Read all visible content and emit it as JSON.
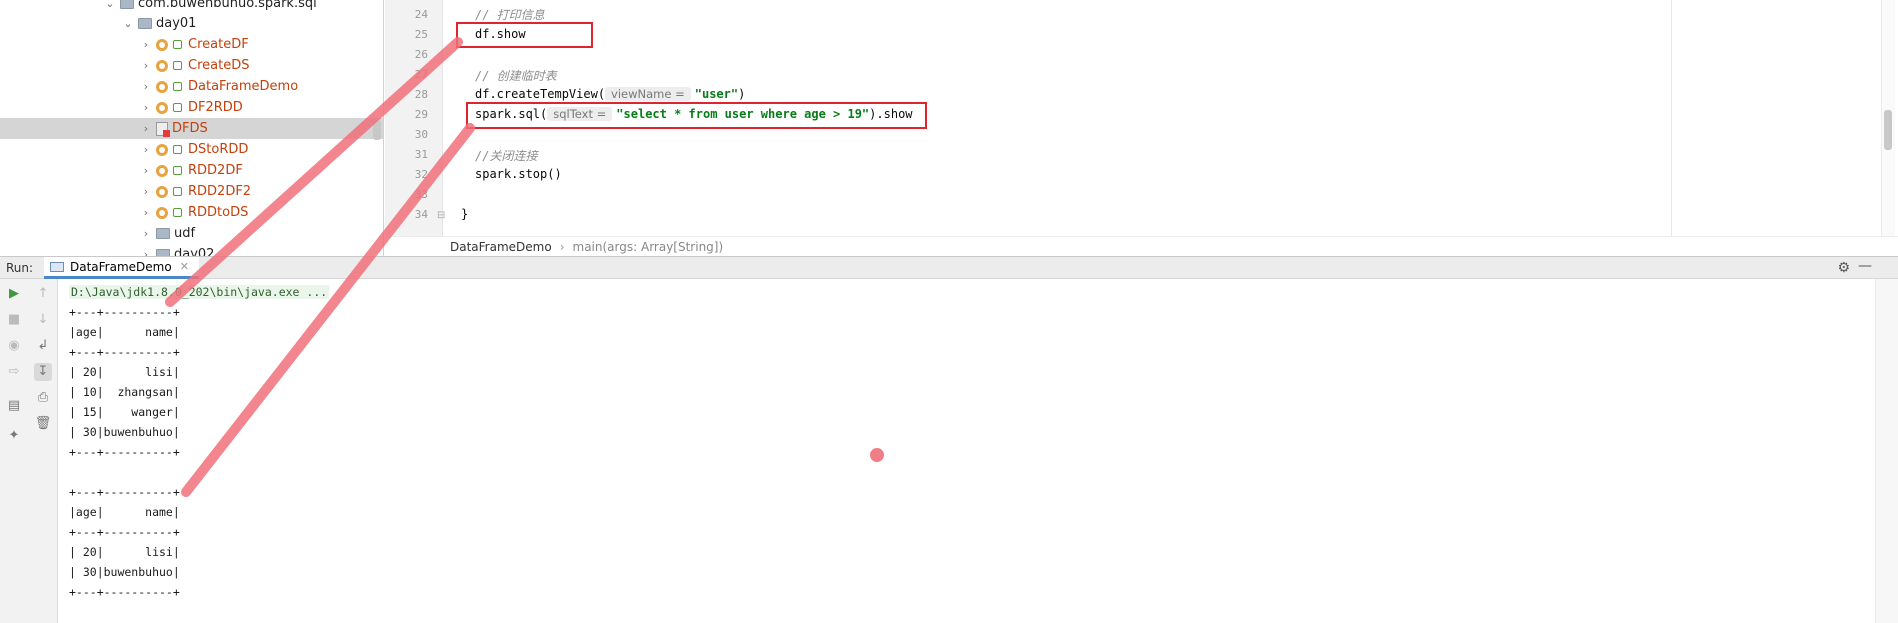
{
  "project_tree": {
    "package_root": "com.buwenbuhuo.spark.sql",
    "day01_label": "day01",
    "classes": [
      "CreateDF",
      "CreateDS",
      "DataFrameDemo",
      "DF2RDD"
    ],
    "selected_item": "DFDS",
    "classes_after": [
      "DStoRDD",
      "RDD2DF",
      "RDD2DF2",
      "RDDtoDS"
    ],
    "udf_label": "udf",
    "day02_label": "day02"
  },
  "editor": {
    "line_numbers": [
      "24",
      "25",
      "26",
      "27",
      "28",
      "29",
      "30",
      "31",
      "32",
      "33",
      "34"
    ],
    "lines": {
      "l24_comment": "// 打印信息",
      "l25_code": "df.show",
      "l27_comment": "// 创建临时表",
      "l28_prefix": "df.createTempView(",
      "l28_hint": "viewName =",
      "l28_string": "\"user\"",
      "l28_suffix": ")",
      "l29_prefix": "spark.sql(",
      "l29_hint": "sqlText =",
      "l29_string": "\"select * from user where age > 19\"",
      "l29_suffix": ").show",
      "l31_comment": "//关闭连接",
      "l32_code": "spark.stop()",
      "l34_code": "}"
    },
    "breadcrumb": {
      "file": "DataFrameDemo",
      "method": "main(args: Array[String])"
    }
  },
  "run_panel": {
    "label": "Run:",
    "tab_label": "DataFrameDemo",
    "command_line": "D:\\Java\\jdk1.8.0_202\\bin\\java.exe ...",
    "output_lines": [
      "+---+----------+",
      "|age|      name|",
      "+---+----------+",
      "| 20|      lisi|",
      "| 10|  zhangsan|",
      "| 15|    wanger|",
      "| 30|buwenbuhuo|",
      "+---+----------+",
      "",
      "+---+----------+",
      "|age|      name|",
      "+---+----------+",
      "| 20|      lisi|",
      "| 30|buwenbuhuo|",
      "+---+----------+"
    ]
  },
  "colors": {
    "annotation_red": "#e0242f",
    "stroke_pink": "#f0707a",
    "class_name": "#c2410c",
    "string_literal": "#067d17"
  },
  "icons": {
    "run": "play-icon",
    "stop": "stop-icon",
    "settings": "gear-icon",
    "close_tab": "close-icon"
  }
}
